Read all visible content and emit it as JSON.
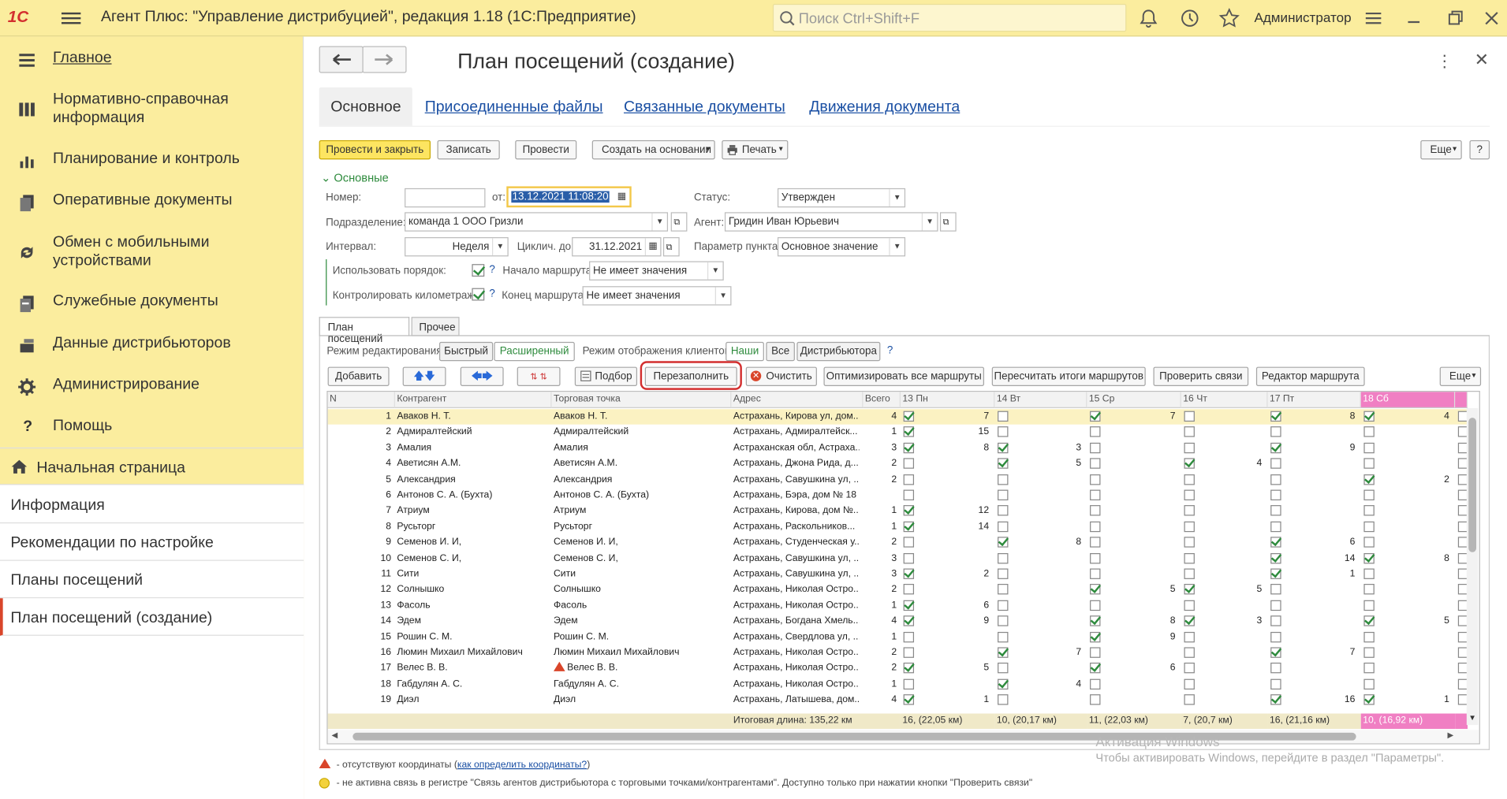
{
  "topbar": {
    "logo": "1С",
    "title": "Агент Плюс: \"Управление дистрибуцией\", редакция 1.18  (1С:Предприятие)",
    "search_placeholder": "Поиск Ctrl+Shift+F",
    "user": "Администратор"
  },
  "sidebar": {
    "items": [
      {
        "label": "Главное",
        "icon": "menu-lines-icon"
      },
      {
        "label": "Нормативно-справочная информация",
        "icon": "catalog-icon"
      },
      {
        "label": "Планирование и контроль",
        "icon": "chart-icon"
      },
      {
        "label": "Оперативные документы",
        "icon": "documents-icon"
      },
      {
        "label": "Обмен с мобильными устройствами",
        "icon": "sync-icon"
      },
      {
        "label": "Служебные документы",
        "icon": "service-docs-icon"
      },
      {
        "label": "Данные дистрибьюторов",
        "icon": "distributor-icon"
      },
      {
        "label": "Администрирование",
        "icon": "gear-icon"
      },
      {
        "label": "Помощь",
        "icon": "question-icon"
      }
    ]
  },
  "nav": {
    "items": [
      "Начальная страница",
      "Информация",
      "Рекомендации по настройке",
      "Планы посещений",
      "План посещений  (создание)"
    ]
  },
  "doc": {
    "title": "План посещений  (создание)",
    "tabs": [
      "Основное",
      "Присоединенные файлы",
      "Связанные документы",
      "Движения документа"
    ]
  },
  "toolbar": {
    "post_close": "Провести и закрыть",
    "save": "Записать",
    "post": "Провести",
    "create_based": "Создать на основании",
    "print": "Печать",
    "more": "Еще",
    "help": "?"
  },
  "form": {
    "group": "Основные",
    "number_label": "Номер:",
    "number_value": "",
    "from_label": "от:",
    "date_value": "13.12.2021 11:08:20",
    "status_label": "Статус:",
    "status_value": "Утвержден",
    "dept_label": "Подразделение:",
    "dept_value": "команда 1 ООО Гризли",
    "agent_label": "Агент:",
    "agent_value": "Гридин Иван Юрьевич",
    "interval_label": "Интервал:",
    "interval_value": "Неделя",
    "cycl_label": "Циклич. до:",
    "cycl_value": "31.12.2021",
    "point_param_label": "Параметр пункта:",
    "point_param_value": "Основное значение",
    "use_order_label": "Использовать порядок:",
    "route_start_label": "Начало маршрута:",
    "route_start_value": "Не имеет значения",
    "km_label": "Контролировать километраж:",
    "route_end_label": "Конец маршрута:",
    "route_end_value": "Не имеет значения",
    "q": "?"
  },
  "inner_tabs": [
    "План посещений",
    "Прочее"
  ],
  "mode": {
    "edit_label": "Режим редактирования:",
    "edit_fast": "Быстрый",
    "edit_ext": "Расширенный",
    "display_label": "Режим отображения клиентов:",
    "ours": "Наши",
    "all": "Все",
    "distributor": "Дистрибьютора",
    "q": "?"
  },
  "grid_toolbar": {
    "add": "Добавить",
    "pick": "Подбор",
    "refill": "Перезаполнить",
    "clear": "Очистить",
    "optimize": "Оптимизировать все маршруты",
    "recalc": "Пересчитать итоги маршрутов",
    "check_links": "Проверить связи",
    "route_editor": "Редактор маршрута",
    "more": "Еще"
  },
  "grid": {
    "headers": {
      "n": "N",
      "counterparty": "Контрагент",
      "outlet": "Торговая точка",
      "address": "Адрес",
      "total": "Всего"
    },
    "days": [
      "13 Пн",
      "14 Вт",
      "15 Ср",
      "16 Чт",
      "17 Пт",
      "18 Сб"
    ],
    "rows": [
      {
        "n": "1",
        "c": "Аваков Н. Т.",
        "o": "Аваков Н. Т.",
        "a": "Астрахань, Кирова ул, дом...",
        "t": "4",
        "d": [
          [
            1,
            "7"
          ],
          [
            0,
            ""
          ],
          [
            1,
            "7"
          ],
          [
            0,
            ""
          ],
          [
            1,
            "8"
          ],
          [
            1,
            "4"
          ]
        ]
      },
      {
        "n": "2",
        "c": "Адмиралтейский",
        "o": "Адмиралтейский",
        "a": "Астрахань, Адмиралтейск...",
        "t": "1",
        "d": [
          [
            1,
            "15"
          ],
          [
            0,
            ""
          ],
          [
            0,
            ""
          ],
          [
            0,
            ""
          ],
          [
            0,
            ""
          ],
          [
            0,
            ""
          ]
        ]
      },
      {
        "n": "3",
        "c": "Амалия",
        "o": "Амалия",
        "a": "Астраханская обл, Астраха...",
        "t": "3",
        "d": [
          [
            1,
            "8"
          ],
          [
            1,
            "3"
          ],
          [
            0,
            ""
          ],
          [
            0,
            ""
          ],
          [
            1,
            "9"
          ],
          [
            0,
            ""
          ]
        ]
      },
      {
        "n": "4",
        "c": "Аветисян А.М.",
        "o": "Аветисян А.М.",
        "a": "Астрахань, Джона Рида, д...",
        "t": "2",
        "d": [
          [
            0,
            ""
          ],
          [
            1,
            "5"
          ],
          [
            0,
            ""
          ],
          [
            1,
            "4"
          ],
          [
            0,
            ""
          ],
          [
            0,
            ""
          ]
        ]
      },
      {
        "n": "5",
        "c": "Александрия",
        "o": "Александрия",
        "a": "Астрахань, Савушкина ул, ...",
        "t": "2",
        "d": [
          [
            0,
            ""
          ],
          [
            0,
            ""
          ],
          [
            0,
            ""
          ],
          [
            0,
            ""
          ],
          [
            0,
            ""
          ],
          [
            1,
            "2"
          ]
        ]
      },
      {
        "n": "6",
        "c": "Антонов С. А. (Бухта)",
        "o": "Антонов С. А. (Бухта)",
        "a": "Астрахань, Бэра, дом № 18",
        "t": "",
        "d": [
          [
            0,
            ""
          ],
          [
            0,
            ""
          ],
          [
            0,
            ""
          ],
          [
            0,
            ""
          ],
          [
            0,
            ""
          ],
          [
            0,
            ""
          ]
        ]
      },
      {
        "n": "7",
        "c": "Атриум",
        "o": "Атриум",
        "a": "Астрахань, Кирова, дом №...",
        "t": "1",
        "d": [
          [
            1,
            "12"
          ],
          [
            0,
            ""
          ],
          [
            0,
            ""
          ],
          [
            0,
            ""
          ],
          [
            0,
            ""
          ],
          [
            0,
            ""
          ]
        ]
      },
      {
        "n": "8",
        "c": "Русьторг",
        "o": "Русьторг",
        "a": "Астрахань, Раскольников...",
        "t": "1",
        "d": [
          [
            1,
            "14"
          ],
          [
            0,
            ""
          ],
          [
            0,
            ""
          ],
          [
            0,
            ""
          ],
          [
            0,
            ""
          ],
          [
            0,
            ""
          ]
        ]
      },
      {
        "n": "9",
        "c": "Семенов И. И,",
        "o": "Семенов И. И,",
        "a": "Астрахань, Студенческая у...",
        "t": "2",
        "d": [
          [
            0,
            ""
          ],
          [
            1,
            "8"
          ],
          [
            0,
            ""
          ],
          [
            0,
            ""
          ],
          [
            1,
            "6"
          ],
          [
            0,
            ""
          ]
        ]
      },
      {
        "n": "10",
        "c": "Семенов С. И,",
        "o": "Семенов С. И,",
        "a": "Астрахань, Савушкина ул, ...",
        "t": "3",
        "d": [
          [
            0,
            ""
          ],
          [
            0,
            ""
          ],
          [
            0,
            ""
          ],
          [
            0,
            ""
          ],
          [
            1,
            "14"
          ],
          [
            1,
            "8"
          ]
        ]
      },
      {
        "n": "11",
        "c": "Сити",
        "o": "Сити",
        "a": "Астрахань, Савушкина ул, ...",
        "t": "3",
        "d": [
          [
            1,
            "2"
          ],
          [
            0,
            ""
          ],
          [
            0,
            ""
          ],
          [
            0,
            ""
          ],
          [
            1,
            "1"
          ],
          [
            0,
            ""
          ]
        ]
      },
      {
        "n": "12",
        "c": "Солнышко",
        "o": "Солнышко",
        "a": "Астрахань, Николая Остро...",
        "t": "2",
        "d": [
          [
            0,
            ""
          ],
          [
            0,
            ""
          ],
          [
            1,
            "5"
          ],
          [
            1,
            "5"
          ],
          [
            0,
            ""
          ],
          [
            0,
            ""
          ]
        ]
      },
      {
        "n": "13",
        "c": "Фасоль",
        "o": "Фасоль",
        "a": "Астрахань, Николая Остро...",
        "t": "1",
        "d": [
          [
            1,
            "6"
          ],
          [
            0,
            ""
          ],
          [
            0,
            ""
          ],
          [
            0,
            ""
          ],
          [
            0,
            ""
          ],
          [
            0,
            ""
          ]
        ]
      },
      {
        "n": "14",
        "c": "Эдем",
        "o": "Эдем",
        "a": "Астрахань, Богдана Хмель...",
        "t": "4",
        "d": [
          [
            1,
            "9"
          ],
          [
            0,
            ""
          ],
          [
            1,
            "8"
          ],
          [
            1,
            "3"
          ],
          [
            0,
            ""
          ],
          [
            1,
            "5"
          ]
        ]
      },
      {
        "n": "15",
        "c": "Рошин С. М.",
        "o": "Рошин С. М.",
        "a": "Астрахань, Свердлова ул, ...",
        "t": "1",
        "d": [
          [
            0,
            ""
          ],
          [
            0,
            ""
          ],
          [
            1,
            "9"
          ],
          [
            0,
            ""
          ],
          [
            0,
            ""
          ],
          [
            0,
            ""
          ]
        ]
      },
      {
        "n": "16",
        "c": "Люмин Михаил Михайлович",
        "o": "Люмин Михаил Михайлович",
        "a": "Астрахань, Николая Остро...",
        "t": "2",
        "d": [
          [
            0,
            ""
          ],
          [
            1,
            "7"
          ],
          [
            0,
            ""
          ],
          [
            0,
            ""
          ],
          [
            1,
            "7"
          ],
          [
            0,
            ""
          ]
        ]
      },
      {
        "n": "17",
        "c": "Велес В. В.",
        "o": "Велес В. В.",
        "a": "Астрахань, Николая Остро...",
        "t": "2",
        "d": [
          [
            1,
            "5"
          ],
          [
            0,
            ""
          ],
          [
            1,
            "6"
          ],
          [
            0,
            ""
          ],
          [
            0,
            ""
          ],
          [
            0,
            ""
          ]
        ]
      },
      {
        "n": "18",
        "c": "Габдулян А. С.",
        "o": "Габдулян А. С.",
        "a": "Астрахань, Николая Остро...",
        "t": "1",
        "d": [
          [
            0,
            ""
          ],
          [
            1,
            "4"
          ],
          [
            0,
            ""
          ],
          [
            0,
            ""
          ],
          [
            0,
            ""
          ],
          [
            0,
            ""
          ]
        ]
      },
      {
        "n": "19",
        "c": "Диэл",
        "o": "Диэл",
        "a": "Астрахань, Латышева, дом...",
        "t": "4",
        "d": [
          [
            1,
            "1"
          ],
          [
            0,
            ""
          ],
          [
            0,
            ""
          ],
          [
            0,
            ""
          ],
          [
            1,
            "16"
          ],
          [
            1,
            "1"
          ]
        ]
      }
    ],
    "footer": {
      "total_len": "Итоговая длина: 135,22 км",
      "days": [
        "16, (22,05 км)",
        "10, (20,17 км)",
        "11, (22,03 км)",
        "7, (20,7 км)",
        "16, (21,16 км)",
        "10, (16,92 км)"
      ]
    }
  },
  "legend": {
    "warn_text": "- отсутствуют координаты (",
    "warn_link": "как определить координаты?",
    "warn_close": ")",
    "info_text": "- не активна связь в регистре \"Связь агентов дистрибьютора с торговыми точками/контрагентами\". Доступно только при нажатии кнопки \"Проверить связи\""
  },
  "watermark": {
    "title": "Активация Windows",
    "text": "Чтобы активировать Windows, перейдите в раздел \"Параметры\"."
  },
  "colors": {
    "topbar": "#fbed9e",
    "accent_yellow": "#fde561",
    "link": "#1a4fa3",
    "highlight_pink": "#f07fc3",
    "refill_ring": "#d32f2f"
  }
}
